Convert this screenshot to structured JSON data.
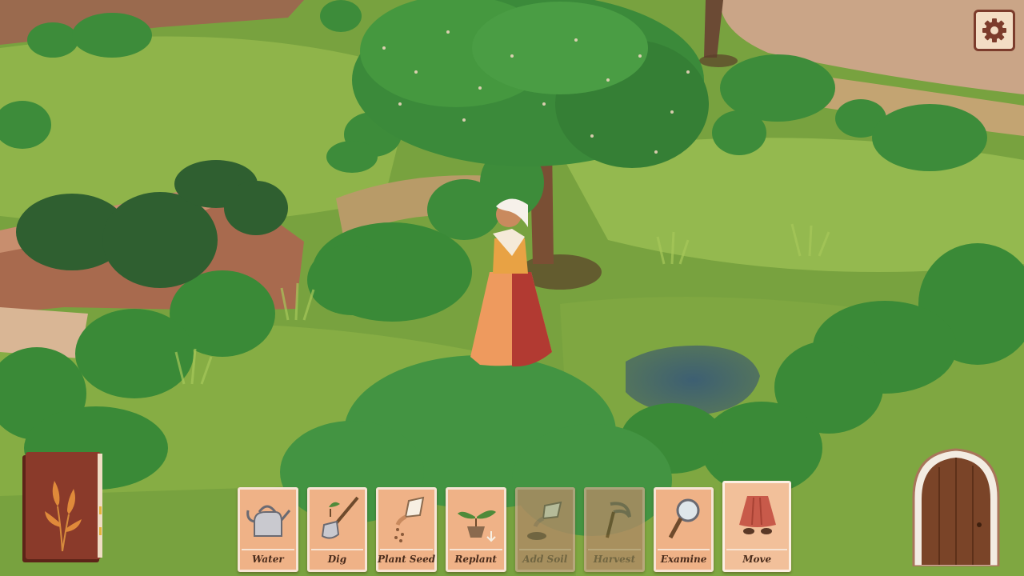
{
  "toolbar": {
    "tools": [
      {
        "label": "Water",
        "icon": "watering-can-icon",
        "state": "enabled"
      },
      {
        "label": "Dig",
        "icon": "shovel-icon",
        "state": "enabled"
      },
      {
        "label": "Plant Seed",
        "icon": "seed-packet-icon",
        "state": "enabled"
      },
      {
        "label": "Replant",
        "icon": "potted-plant-icon",
        "state": "enabled"
      },
      {
        "label": "Add Soil",
        "icon": "soil-bag-icon",
        "state": "disabled"
      },
      {
        "label": "Harvest",
        "icon": "sickle-icon",
        "state": "disabled"
      },
      {
        "label": "Examine",
        "icon": "magnifying-glass-icon",
        "state": "enabled"
      },
      {
        "label": "Move",
        "icon": "skirt-feet-icon",
        "state": "selected"
      }
    ]
  },
  "hud": {
    "settings_icon": "gear-icon",
    "journal_icon": "iris-book-icon",
    "exit_icon": "wooden-door-icon"
  },
  "colors": {
    "card": "#efb287",
    "card_border": "#f7e4d4",
    "card_disabled": "#b48a67",
    "label_text": "#4a2c1c",
    "settings_border": "#7c3c2c",
    "journal_cover": "#8a3a2a"
  }
}
